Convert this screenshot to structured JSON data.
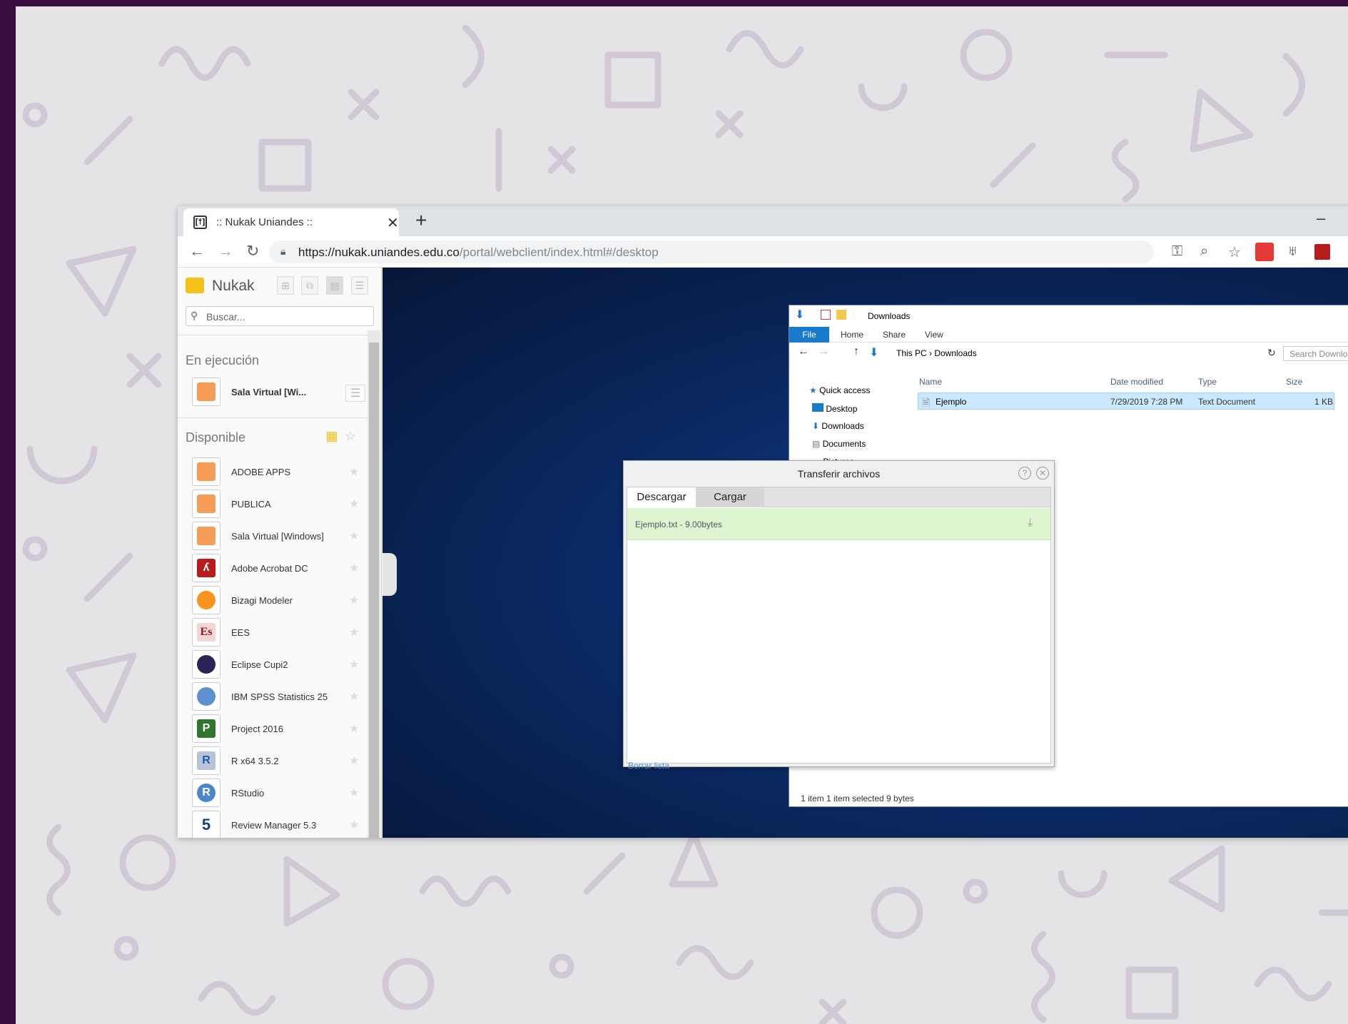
{
  "browser": {
    "tab_title": ":: Nukak Uniandes ::",
    "favicon_text": "[†]",
    "new_tab": "+",
    "url_host": "https://nukak.uniandes.edu.co",
    "url_path": "/portal/webclient/index.html#/desktop"
  },
  "nukak": {
    "brand": "Nukak",
    "search_placeholder": "Buscar...",
    "running_title": "En ejecución",
    "running_apps": [
      {
        "label": "Sala Virtual [Wi...",
        "icon": "cloud-desktop-icon"
      }
    ],
    "available_title": "Disponible",
    "available_apps": [
      {
        "label": "ADOBE APPS",
        "icon": "cloud-desktop-icon"
      },
      {
        "label": "PUBLICA",
        "icon": "cloud-desktop-icon"
      },
      {
        "label": "Sala Virtual [Windows]",
        "icon": "cloud-desktop-icon"
      },
      {
        "label": "Adobe Acrobat DC",
        "icon": "acrobat-icon"
      },
      {
        "label": "Bizagi Modeler",
        "icon": "bizagi-icon"
      },
      {
        "label": "EES",
        "icon": "ees-icon"
      },
      {
        "label": "Eclipse Cupi2",
        "icon": "eclipse-icon"
      },
      {
        "label": "IBM SPSS Statistics 25",
        "icon": "spss-icon"
      },
      {
        "label": "Project 2016",
        "icon": "project-icon"
      },
      {
        "label": "R x64 3.5.2",
        "icon": "r-icon"
      },
      {
        "label": "RStudio",
        "icon": "rstudio-icon"
      },
      {
        "label": "Review Manager 5.3",
        "icon": "review-manager-icon"
      }
    ]
  },
  "explorer": {
    "title": "Downloads",
    "ribbon": {
      "file": "File",
      "home": "Home",
      "share": "Share",
      "view": "View"
    },
    "breadcrumb": "This PC  ›  Downloads",
    "search_placeholder": "Search Downloads",
    "nav": [
      "Quick access",
      "Desktop",
      "Downloads",
      "Documents",
      "Pictures"
    ],
    "columns": {
      "name": "Name",
      "date": "Date modified",
      "type": "Type",
      "size": "Size"
    },
    "rows": [
      {
        "name": "Ejemplo",
        "date": "7/29/2019 7:28 PM",
        "type": "Text Document",
        "size": "1 KB"
      }
    ],
    "status": "1 item     1 item selected  9 bytes"
  },
  "dialog": {
    "title": "Transferir archivos",
    "tabs": {
      "download": "Descargar",
      "upload": "Cargar"
    },
    "file_entry": "Ejemplo.txt - 9.00bytes",
    "clear_link": "Borrar lista"
  },
  "colors": {
    "slide_bg": "#e4e4e6",
    "frame": "#3a0e3f",
    "file_tab": "#1979ca",
    "selection": "#cce8ff",
    "download_row": "#dff5d0"
  }
}
